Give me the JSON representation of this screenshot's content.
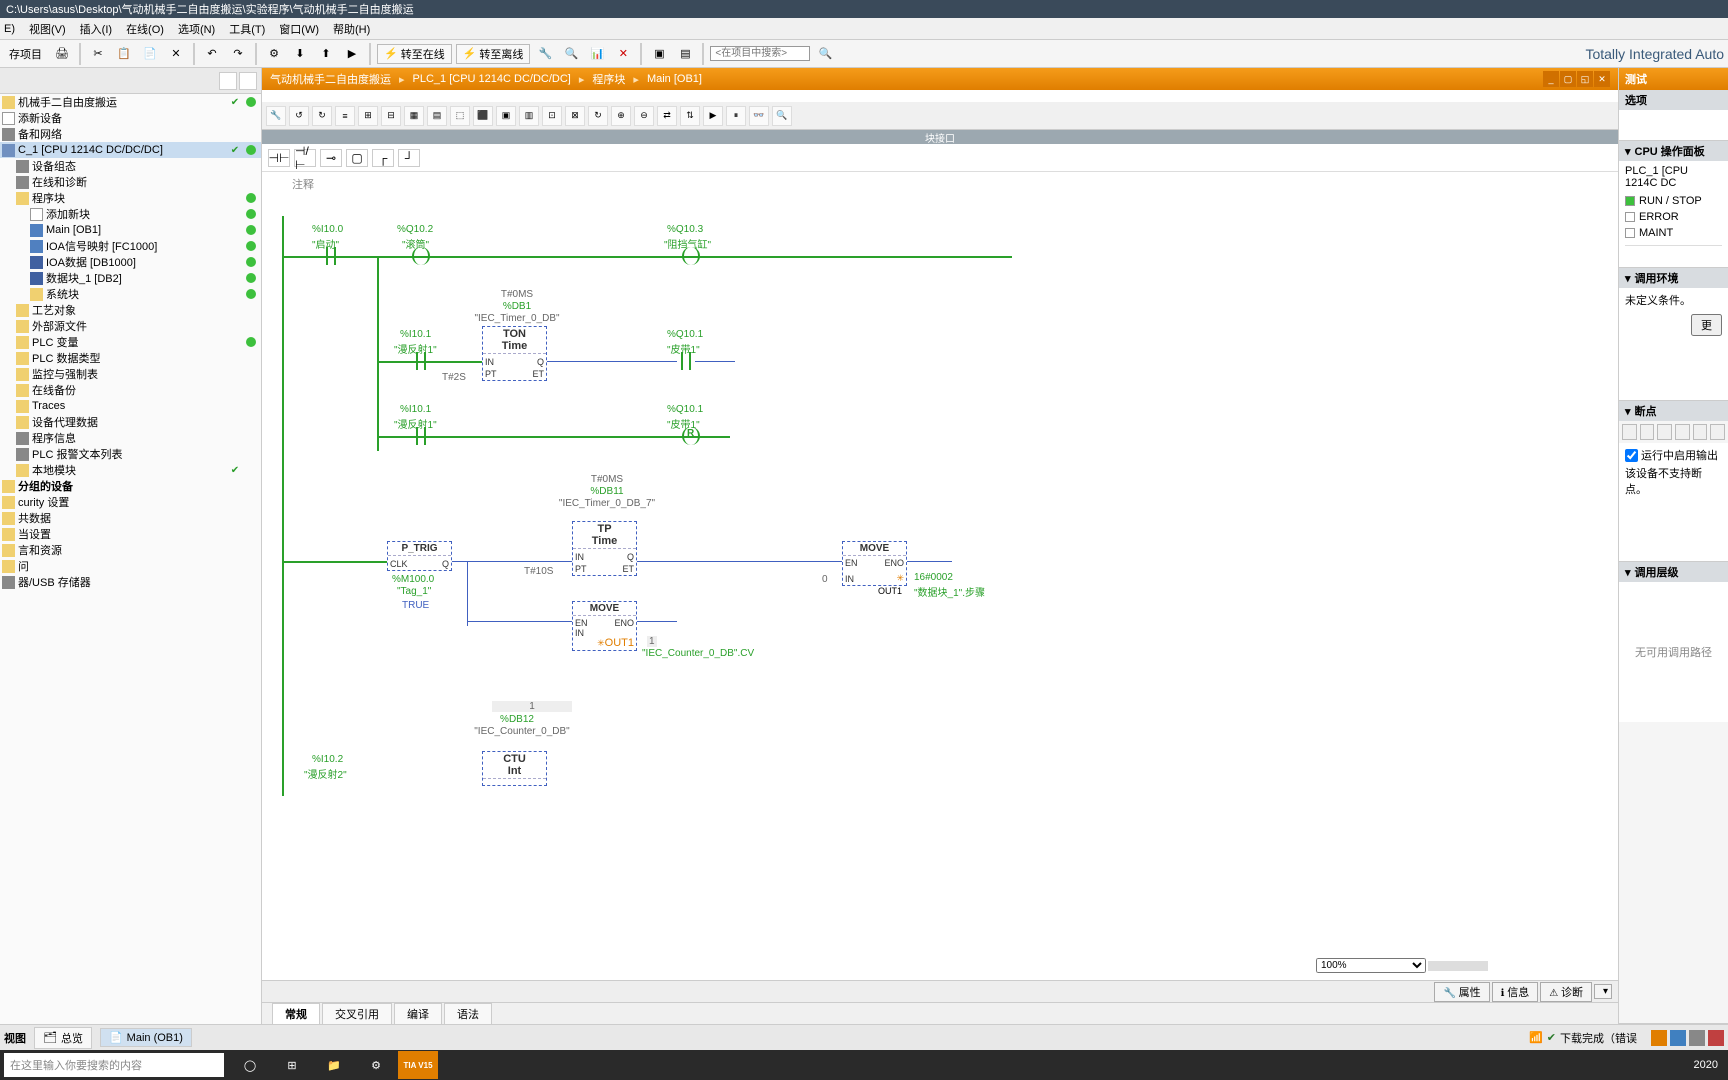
{
  "title_path": "C:\\Users\\asus\\Desktop\\气动机械手二自由度搬运\\实验程序\\气动机械手二自由度搬运",
  "menu": [
    "E)",
    "视图(V)",
    "插入(I)",
    "在线(O)",
    "选项(N)",
    "工具(T)",
    "窗口(W)",
    "帮助(H)"
  ],
  "toolbar": {
    "save_label": "存项目",
    "go_online": "转至在线",
    "go_offline": "转至离线",
    "search_placeholder": "<在项目中搜索>",
    "brand": "Totally Integrated Auto"
  },
  "breadcrumb": [
    "气动机械手二自由度搬运",
    "PLC_1 [CPU 1214C DC/DC/DC]",
    "程序块",
    "Main [OB1]"
  ],
  "tree": [
    {
      "label": "机械手二自由度搬运",
      "indent": 0,
      "icon": "ico-folder",
      "check": true,
      "dot": true
    },
    {
      "label": "添新设备",
      "indent": 0,
      "icon": "ico-add"
    },
    {
      "label": "备和网络",
      "indent": 0,
      "icon": "ico-generic"
    },
    {
      "label": "C_1 [CPU 1214C DC/DC/DC]",
      "indent": 0,
      "icon": "ico-device",
      "check": true,
      "dot": true,
      "selected": true
    },
    {
      "label": "设备组态",
      "indent": 1,
      "icon": "ico-generic"
    },
    {
      "label": "在线和诊断",
      "indent": 1,
      "icon": "ico-generic"
    },
    {
      "label": "程序块",
      "indent": 1,
      "icon": "ico-folder",
      "dot": true
    },
    {
      "label": "添加新块",
      "indent": 2,
      "icon": "ico-add",
      "dot": true
    },
    {
      "label": "Main [OB1]",
      "indent": 2,
      "icon": "ico-block",
      "dot": true
    },
    {
      "label": "IOA信号映射 [FC1000]",
      "indent": 2,
      "icon": "ico-block",
      "dot": true
    },
    {
      "label": "IOA数据 [DB1000]",
      "indent": 2,
      "icon": "ico-db",
      "dot": true
    },
    {
      "label": "数据块_1 [DB2]",
      "indent": 2,
      "icon": "ico-db",
      "dot": true
    },
    {
      "label": "系统块",
      "indent": 2,
      "icon": "ico-folder",
      "dot": true
    },
    {
      "label": "工艺对象",
      "indent": 1,
      "icon": "ico-folder"
    },
    {
      "label": "外部源文件",
      "indent": 1,
      "icon": "ico-folder"
    },
    {
      "label": "PLC 变量",
      "indent": 1,
      "icon": "ico-folder",
      "dot": true
    },
    {
      "label": "PLC 数据类型",
      "indent": 1,
      "icon": "ico-folder"
    },
    {
      "label": "监控与强制表",
      "indent": 1,
      "icon": "ico-folder"
    },
    {
      "label": "在线备份",
      "indent": 1,
      "icon": "ico-folder"
    },
    {
      "label": "Traces",
      "indent": 1,
      "icon": "ico-folder"
    },
    {
      "label": "设备代理数据",
      "indent": 1,
      "icon": "ico-folder"
    },
    {
      "label": "程序信息",
      "indent": 1,
      "icon": "ico-generic"
    },
    {
      "label": "PLC 报警文本列表",
      "indent": 1,
      "icon": "ico-generic"
    },
    {
      "label": "本地模块",
      "indent": 1,
      "icon": "ico-folder",
      "check": true
    },
    {
      "label": "分组的设备",
      "indent": 0,
      "icon": "ico-folder",
      "bold": true
    },
    {
      "label": "curity 设置",
      "indent": 0,
      "icon": "ico-folder"
    },
    {
      "label": "共数据",
      "indent": 0,
      "icon": "ico-folder"
    },
    {
      "label": "当设置",
      "indent": 0,
      "icon": "ico-folder"
    },
    {
      "label": "言和资源",
      "indent": 0,
      "icon": "ico-folder"
    },
    {
      "label": "问",
      "indent": 0,
      "icon": "ico-folder"
    },
    {
      "label": "器/USB 存储器",
      "indent": 0,
      "icon": "ico-generic"
    }
  ],
  "ladder": {
    "network_comment": "注释",
    "i100": {
      "addr": "%I10.0",
      "name": "\"启动\""
    },
    "q102": {
      "addr": "%Q10.2",
      "name": "\"滚筒\""
    },
    "q103": {
      "addr": "%Q10.3",
      "name": "\"阻挡气缸\""
    },
    "i101_a": {
      "addr": "%I10.1",
      "name": "\"漫反射1\""
    },
    "q101_a": {
      "addr": "%Q10.1",
      "name": "\"皮带1\""
    },
    "i101_b": {
      "addr": "%I10.1",
      "name": "\"漫反射1\""
    },
    "q101_b": {
      "addr": "%Q10.1",
      "name": "\"皮带1\""
    },
    "ton_db": {
      "t": "T#0MS",
      "db": "%DB1",
      "name": "\"IEC_Timer_0_DB\"",
      "type1": "TON",
      "type2": "Time",
      "pt": "T#2S"
    },
    "tp_db": {
      "t": "T#0MS",
      "db": "%DB11",
      "name": "\"IEC_Timer_0_DB_7\"",
      "type1": "TP",
      "type2": "Time",
      "pt": "T#10S"
    },
    "ptrig": {
      "name": "P_TRIG",
      "clk": "CLK",
      "q": "Q",
      "m": "%M100.0",
      "tag": "\"Tag_1\"",
      "true": "TRUE"
    },
    "move1": {
      "name": "MOVE",
      "en": "EN",
      "eno": "ENO",
      "in": "IN",
      "out1": "OUT1",
      "out_val": "\"IEC_Counter_0_DB\".CV",
      "one": "1"
    },
    "move2": {
      "name": "MOVE",
      "en": "EN",
      "eno": "ENO",
      "in": "IN",
      "out1": "OUT1",
      "in_val": "0",
      "hex": "16#0002",
      "out_val": "\"数据块_1\".步骤"
    },
    "ctu": {
      "one": "1",
      "db": "%DB12",
      "name": "\"IEC_Counter_0_DB\"",
      "type1": "CTU",
      "type2": "Int"
    },
    "i102": {
      "addr": "%I10.2",
      "name": "\"漫反射2\""
    }
  },
  "editor_header": "块接口",
  "bottom_tabs": [
    "常规",
    "交叉引用",
    "编译",
    "语法"
  ],
  "info_tabs": [
    "属性",
    "信息",
    "诊断"
  ],
  "zoom": "100%",
  "right": {
    "title": "测试",
    "options": "选项",
    "cpu_panel": "CPU 操作面板",
    "plc_name": "PLC_1 [CPU 1214C DC",
    "run_stop": "RUN / STOP",
    "error": "ERROR",
    "maint": "MAINT",
    "call_env": "调用环境",
    "undefined_cond": "未定义条件。",
    "update_btn": "更",
    "breakpoints": "断点",
    "bp_enable": "运行中启用输出",
    "bp_unsupported": "该设备不支持断点。",
    "call_hier": "调用层级",
    "no_path": "无可用调用路径"
  },
  "taskbar": {
    "view": "视图",
    "overview": "总览",
    "main_ob1": "Main (OB1)",
    "download_done": "下载完成（错误"
  },
  "os": {
    "search_placeholder": "在这里输入你要搜索的内容",
    "tia": "TIA V15",
    "year": "2020"
  }
}
